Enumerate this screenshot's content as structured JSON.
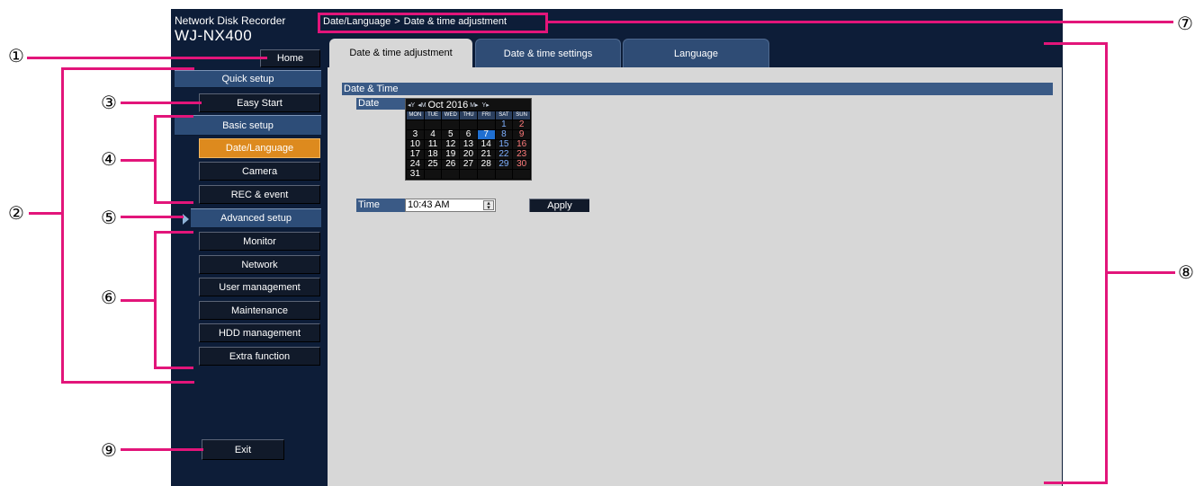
{
  "header": {
    "product_line": "Network Disk Recorder",
    "model": "WJ-NX400"
  },
  "breadcrumb": {
    "parent": "Date/Language",
    "separator": ">",
    "current": "Date & time adjustment"
  },
  "side_menu": {
    "home": "Home",
    "quick_setup": "Quick setup",
    "easy_start": "Easy Start",
    "basic_setup": "Basic setup",
    "basic_items": [
      "Date/Language",
      "Camera",
      "REC & event"
    ],
    "advanced_setup": "Advanced setup",
    "advanced_items": [
      "Monitor",
      "Network",
      "User management",
      "Maintenance",
      "HDD management",
      "Extra function"
    ],
    "exit": "Exit",
    "active_item": "Date/Language"
  },
  "tabs": [
    "Date & time adjustment",
    "Date & time settings",
    "Language"
  ],
  "active_tab": "Date & time adjustment",
  "content": {
    "section_title": "Date & Time",
    "date_label": "Date",
    "time_label": "Time",
    "time_value": "10:43 AM",
    "apply_label": "Apply"
  },
  "calendar": {
    "nav_year_prev": "◂Y",
    "nav_month_prev": "◂M",
    "title": "Oct 2016",
    "nav_month_next": "M▸",
    "nav_year_next": "Y▸",
    "weekdays": [
      "MON",
      "TUE",
      "WED",
      "THU",
      "FRI",
      "SAT",
      "SUN"
    ],
    "weeks": [
      [
        "",
        "",
        "",
        "",
        "",
        "1",
        "2"
      ],
      [
        "3",
        "4",
        "5",
        "6",
        "7",
        "8",
        "9"
      ],
      [
        "10",
        "11",
        "12",
        "13",
        "14",
        "15",
        "16"
      ],
      [
        "17",
        "18",
        "19",
        "20",
        "21",
        "22",
        "23"
      ],
      [
        "24",
        "25",
        "26",
        "27",
        "28",
        "29",
        "30"
      ],
      [
        "31",
        "",
        "",
        "",
        "",
        "",
        ""
      ]
    ],
    "selected_day": "7"
  },
  "annotations": [
    "①",
    "②",
    "③",
    "④",
    "⑤",
    "⑥",
    "⑦",
    "⑧",
    "⑨"
  ],
  "colors": {
    "frame_bg": "#0d1d38",
    "menu_blue": "#2d4d78",
    "active_orange": "#dd8a1e",
    "content_bg": "#d7d7d7",
    "annotation_pink": "#e2157a",
    "calendar_selected": "#1f6fd1"
  }
}
